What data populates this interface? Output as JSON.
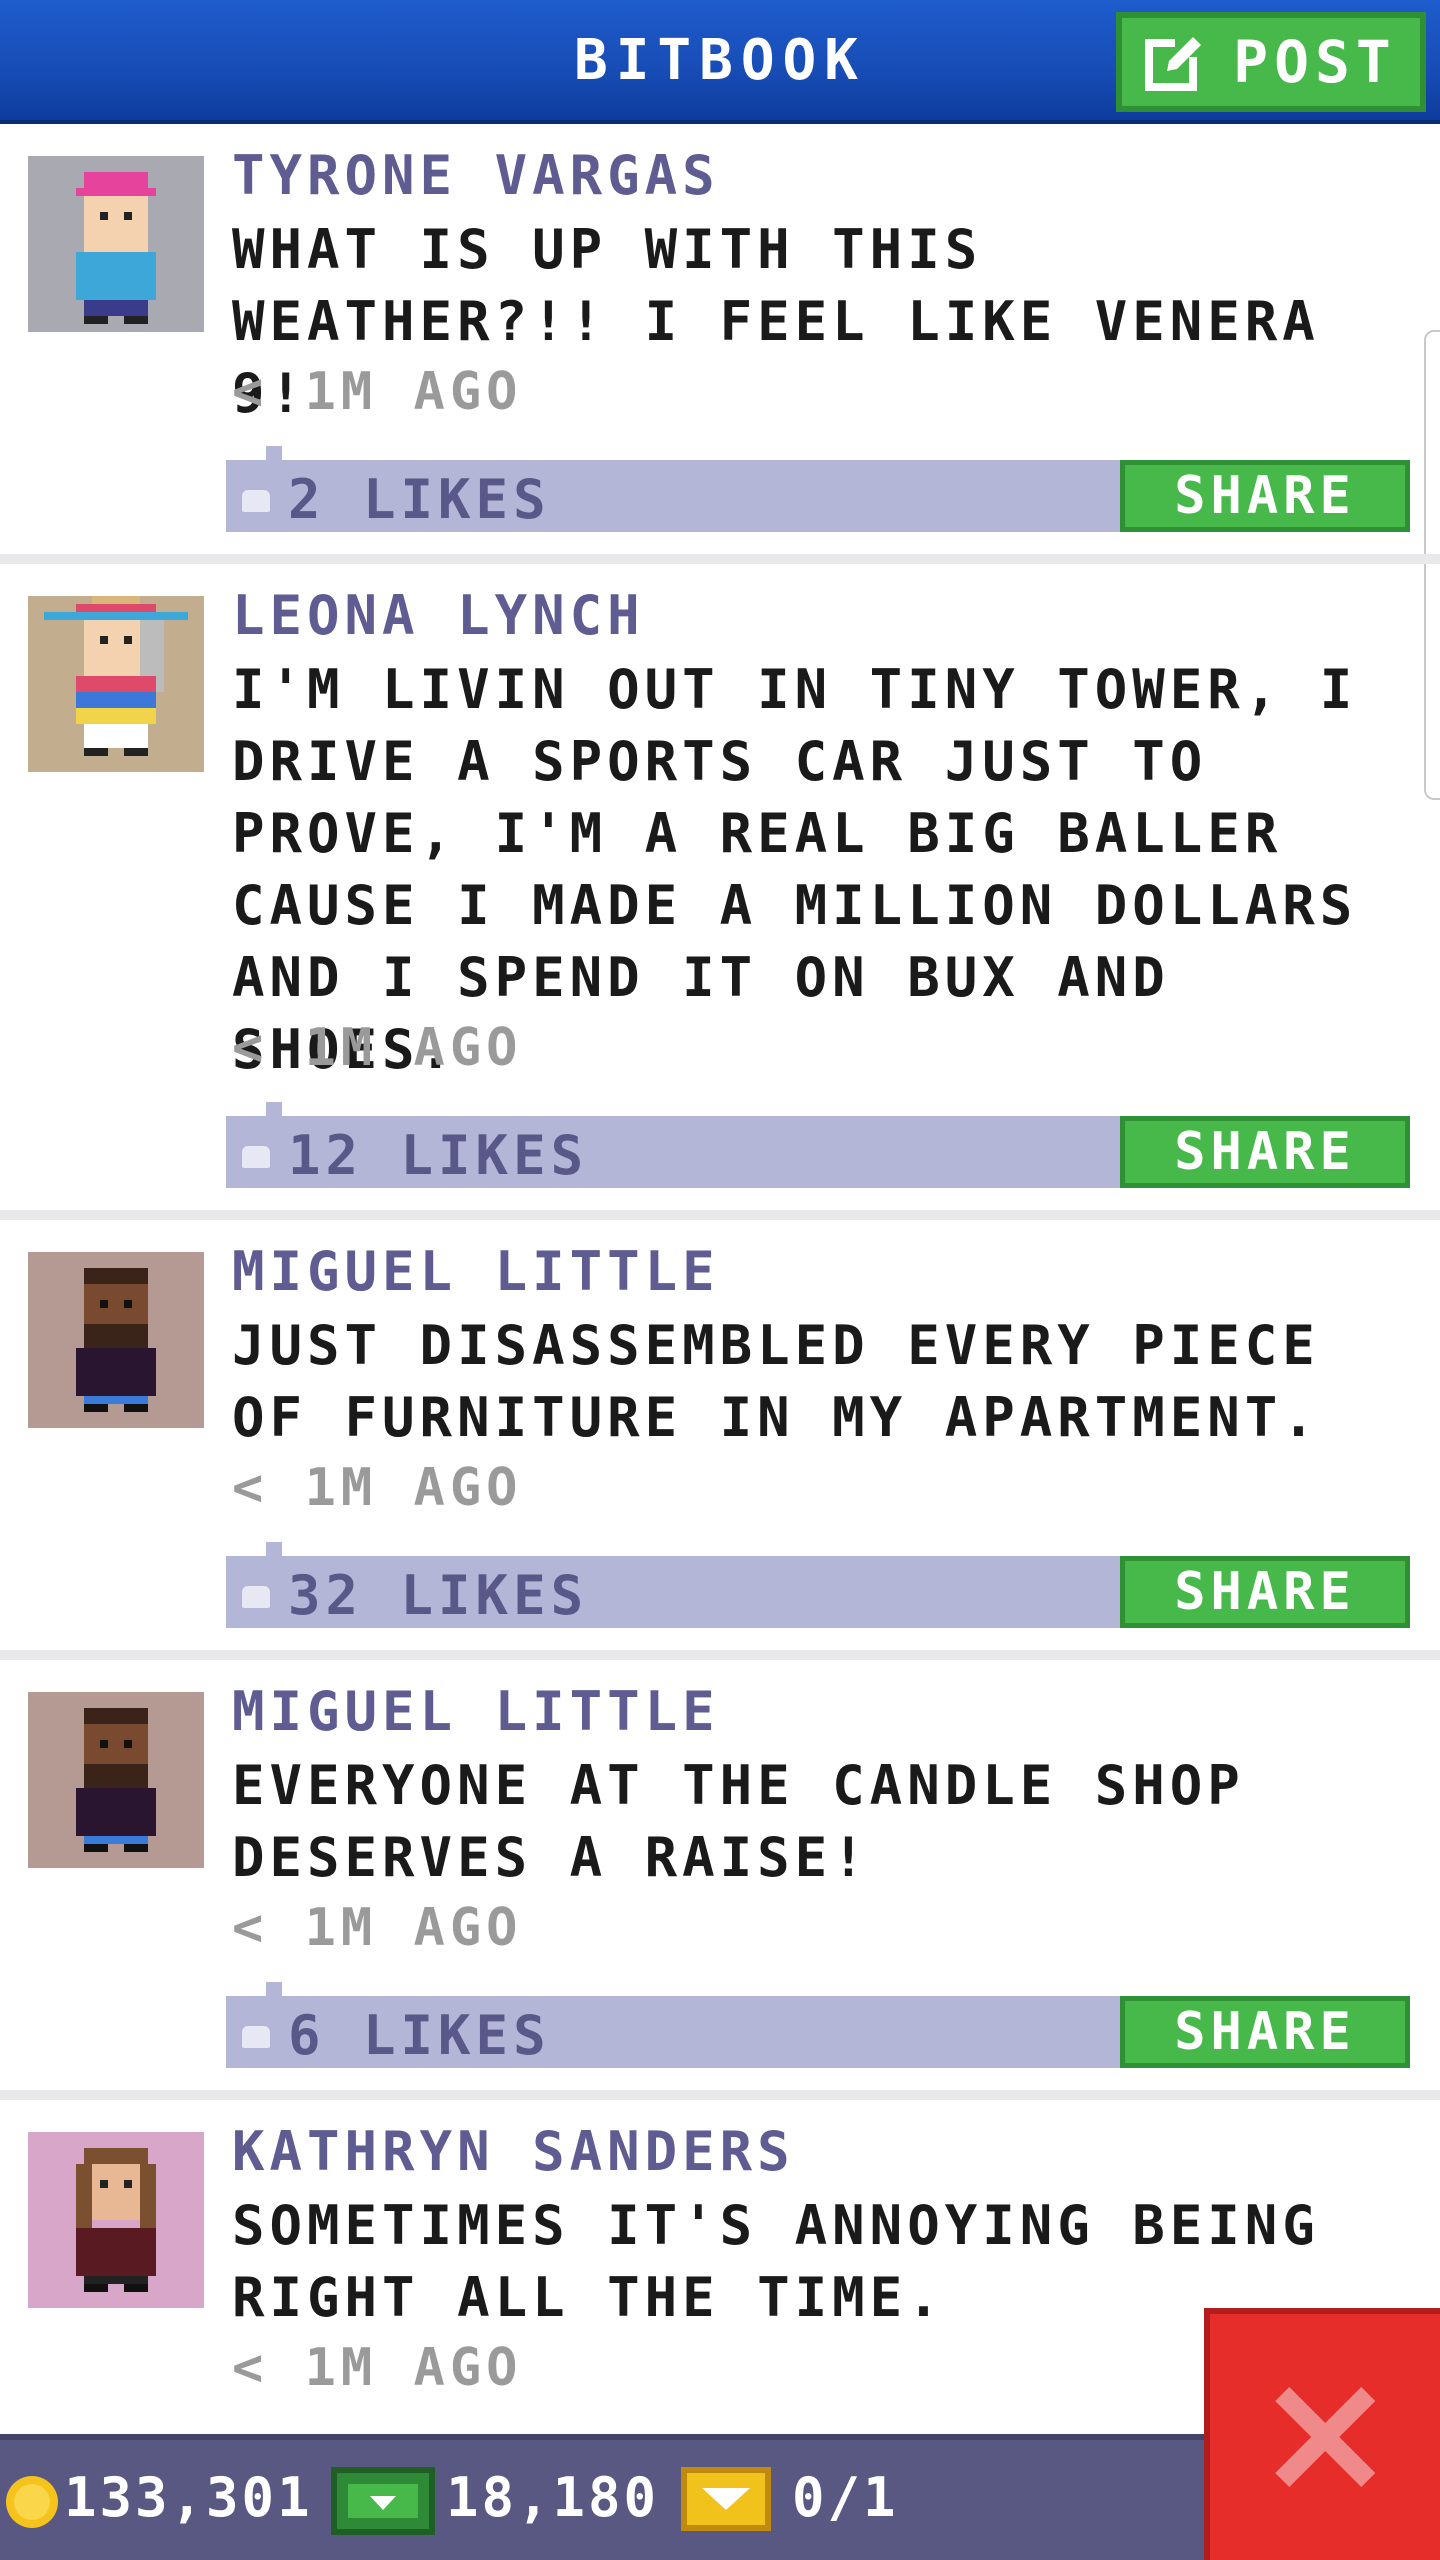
{
  "header": {
    "title": "BITBOOK",
    "post_label": "POST"
  },
  "posts": [
    {
      "name": "TYRONE VARGAS",
      "text": "WHAT IS UP WITH THIS WEATHER?!! I FEEL LIKE VENERA 9!",
      "time": "< 1M AGO",
      "likes": "2 LIKES",
      "share": "SHARE",
      "avatar_bg": "#a9a9b1"
    },
    {
      "name": "LEONA LYNCH",
      "text": "I'M LIVIN OUT IN TINY TOWER, I DRIVE A SPORTS CAR JUST TO PROVE, I'M A REAL BIG BALLER CAUSE I MADE A MILLION DOLLARS AND I SPEND IT ON BUX AND SHOES.",
      "time": "< 1M AGO",
      "likes": "12 LIKES",
      "share": "SHARE",
      "avatar_bg": "#c2ae8e"
    },
    {
      "name": "MIGUEL LITTLE",
      "text": "JUST DISASSEMBLED EVERY PIECE OF FURNITURE IN MY APARTMENT.",
      "time": "< 1M AGO",
      "likes": "32 LIKES",
      "share": "SHARE",
      "avatar_bg": "#b59a94"
    },
    {
      "name": "MIGUEL LITTLE",
      "text": "EVERYONE AT THE CANDLE SHOP DESERVES A RAISE!",
      "time": "< 1M AGO",
      "likes": "6 LIKES",
      "share": "SHARE",
      "avatar_bg": "#b59a94"
    },
    {
      "name": "KATHRYN SANDERS",
      "text": "SOMETIMES IT'S ANNOYING BEING RIGHT ALL THE TIME.",
      "time": "< 1M AGO",
      "avatar_bg": "#d8a6c8"
    }
  ],
  "footer": {
    "coins": "133,301",
    "bux": "18,180",
    "tickets": "0/1"
  },
  "colors": {
    "header_blue": "#174cb5",
    "green": "#47b84a",
    "likes_bar": "#b4b6d8",
    "close_red": "#e62d2a"
  },
  "icons": {
    "post": "compose-icon",
    "like": "thumb-icon",
    "coins": "coin-icon",
    "bux": "bux-icon",
    "tickets": "ticket-icon",
    "close": "close-icon"
  }
}
